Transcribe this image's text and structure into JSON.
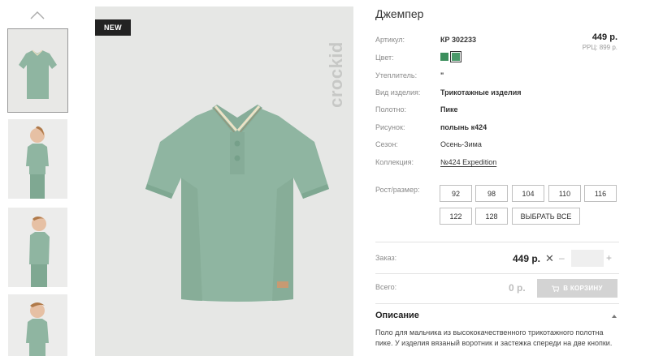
{
  "product": {
    "title": "Джемпер",
    "badge": "NEW",
    "brand": "crockid",
    "price": "449 р.",
    "rrp": "РРЦ: 899 р."
  },
  "specs": [
    {
      "label": "Артикул:",
      "value": "КР 302233"
    },
    {
      "label": "Цвет:",
      "value": ""
    },
    {
      "label": "Утеплитель:",
      "value": "\""
    },
    {
      "label": "Вид изделия:",
      "value": "Трикотажные изделия"
    },
    {
      "label": "Полотно:",
      "value": "Пике"
    },
    {
      "label": "Рисунок:",
      "value": "полынь к424"
    },
    {
      "label": "Сезон:",
      "value": "Осень-Зима"
    },
    {
      "label": "Коллекция:",
      "value": "№424 Expedition"
    }
  ],
  "colors": [
    "#3c8f5d",
    "#4a9a6a"
  ],
  "sizes": {
    "label": "Рост/размер:",
    "options": [
      "92",
      "98",
      "104",
      "110",
      "116",
      "122",
      "128"
    ],
    "select_all": "ВЫБРАТЬ ВСЕ"
  },
  "order": {
    "label": "Заказ:",
    "price": "449 р.",
    "remove_symbol": "✕",
    "minus": "–",
    "plus": "+"
  },
  "total": {
    "label": "Всего:",
    "value": "0 р.",
    "cart_button": "В КОРЗИНУ"
  },
  "description": {
    "title": "Описание",
    "text": "Поло для мальчика из высококачественного трикотажного полотна пике. У изделия вязаный воротник и застежка спереди на две кнопки."
  },
  "accent_colors": {
    "garment": "#8fb5a1",
    "badge_bg": "#222222",
    "cart_disabled": "#d3d3d3"
  }
}
